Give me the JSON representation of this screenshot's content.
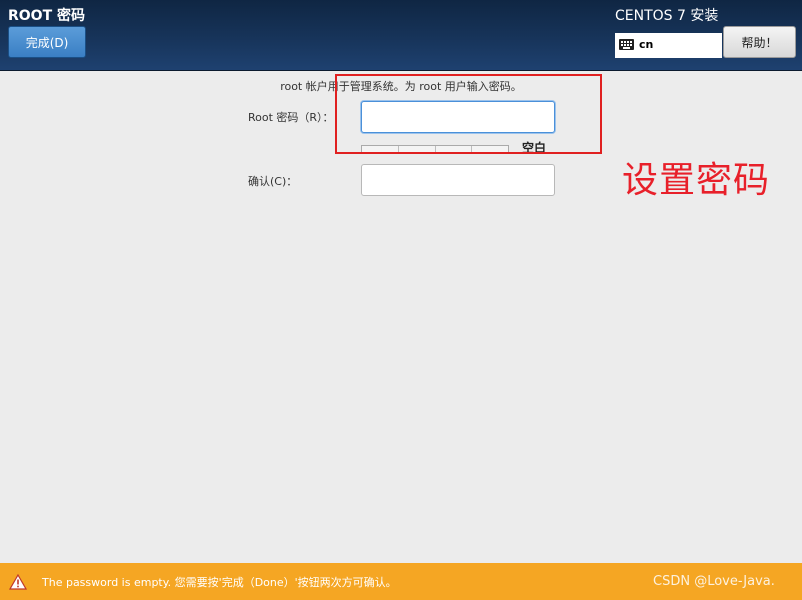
{
  "header": {
    "title": "ROOT 密码",
    "done_label": "完成(D)",
    "install_title": "CENTOS 7 安装",
    "keyboard_layout": "cn",
    "help_label": "帮助！"
  },
  "form": {
    "description": "root 帐户用于管理系统。为 root 用户输入密码。",
    "password_label": "Root 密码（R）：",
    "password_value": "",
    "strength_text": "空白",
    "strength_level": 0,
    "confirm_label": "确认(C)：",
    "confirm_value": ""
  },
  "annotation": {
    "text": "设置密码",
    "color": "#e8202a"
  },
  "footer": {
    "message": "The password is empty. 您需要按'完成（Done）'按钮两次方可确认。",
    "watermark": "CSDN @Love-Java."
  },
  "colors": {
    "header_bg": "#17345a",
    "accent": "#3a7fc4",
    "warning": "#f5a623"
  }
}
